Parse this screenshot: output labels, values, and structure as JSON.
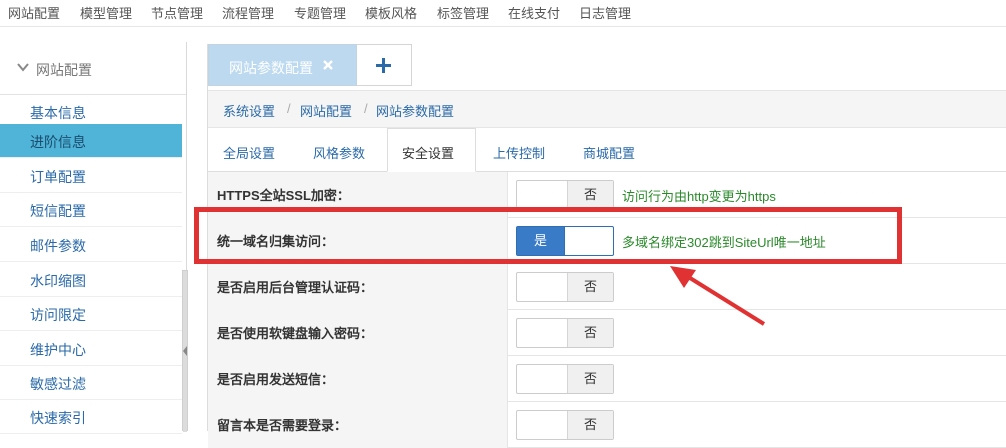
{
  "topnav": {
    "items": [
      "网站配置",
      "模型管理",
      "节点管理",
      "流程管理",
      "专题管理",
      "模板风格",
      "标签管理",
      "在线支付",
      "日志管理"
    ]
  },
  "sidebar": {
    "header": "网站配置",
    "items": [
      {
        "label": "基本信息"
      },
      {
        "label": "进阶信息",
        "active": true
      },
      {
        "label": "订单配置"
      },
      {
        "label": "短信配置"
      },
      {
        "label": "邮件参数"
      },
      {
        "label": "水印缩图"
      },
      {
        "label": "访问限定"
      },
      {
        "label": "维护中心"
      },
      {
        "label": "敏感过滤"
      },
      {
        "label": "快速索引"
      }
    ]
  },
  "page_tab": {
    "label": "网站参数配置"
  },
  "breadcrumb": [
    "系统设置",
    "网站配置",
    "网站参数配置"
  ],
  "settings_tabs": {
    "items": [
      "全局设置",
      "风格参数",
      "安全设置",
      "上传控制",
      "商城配置"
    ],
    "active": "安全设置"
  },
  "rows": [
    {
      "label": "HTTPS全站SSL加密：",
      "value": "否",
      "hint": "访问行为由http变更为https"
    },
    {
      "label": "统一域名归集访问：",
      "value": "是",
      "hint": "多域名绑定302跳到SiteUrl唯一地址"
    },
    {
      "label": "是否启用后台管理认证码：",
      "value": "否"
    },
    {
      "label": "是否使用软键盘输入密码：",
      "value": "否"
    },
    {
      "label": "是否启用发送短信：",
      "value": "否"
    },
    {
      "label": "留言本是否需要登录：",
      "value": "否"
    }
  ],
  "colors": {
    "sidebar_active": "#4fb4d8",
    "link": "#2a6aa8",
    "toggle_on": "#3a7bc8",
    "hint": "#2a8a2a",
    "annotation": "#e03232"
  }
}
